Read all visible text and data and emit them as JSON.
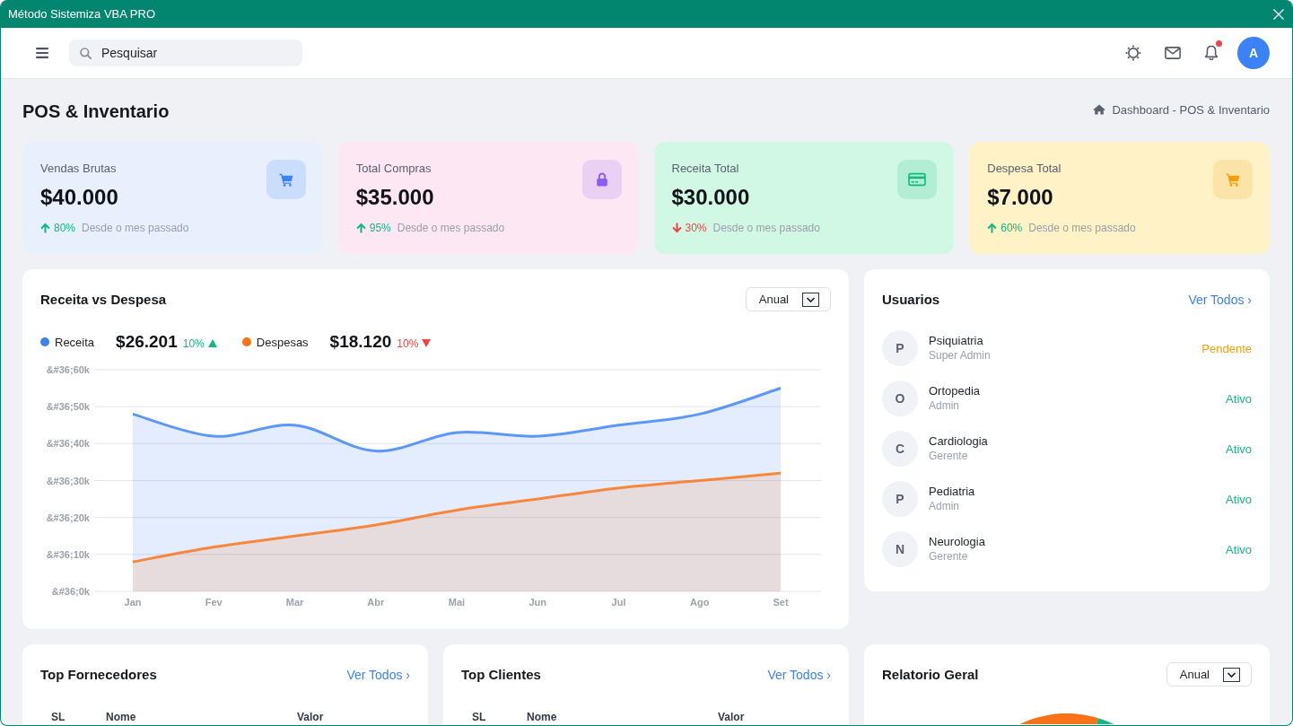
{
  "window": {
    "title": "Método Sistemiza VBA PRO"
  },
  "topbar": {
    "search": {
      "placeholder": "Pesquisar"
    },
    "notifications": {
      "unread": true
    },
    "avatar": {
      "initial": "A"
    }
  },
  "page": {
    "title": "POS & Inventario",
    "breadcrumb": "Dashboard - POS & Inventario"
  },
  "stats": [
    {
      "label": "Vendas Brutas",
      "value": "$40.000",
      "up": true,
      "change": "80%",
      "note": "Desde o mes passado",
      "color": "#e8effd",
      "icon": {
        "color": "#3b82f6"
      }
    },
    {
      "label": "Total Compras",
      "value": "$35.000",
      "up": true,
      "change": "95%",
      "note": "Desde o mes passado",
      "color": "#fde7f2",
      "icon": {
        "color": "#8b5cf6"
      }
    },
    {
      "label": "Receita Total",
      "value": "$30.000",
      "up": false,
      "change": "30%",
      "note": "Desde o mes passado",
      "color": "#d1f8e5",
      "icon": {
        "color": "#10b981"
      }
    },
    {
      "label": "Despesa Total",
      "value": "$7.000",
      "up": true,
      "change": "60%",
      "note": "Desde o mes passado",
      "color": "#fef2c6",
      "icon": {
        "color": "#f59e0b"
      }
    }
  ],
  "revenue_chart": {
    "title": "Receita vs Despesa",
    "period": "Anual",
    "legend": [
      {
        "label": "Receita",
        "color": "#3b82f6",
        "amount": "$26.201",
        "change": "10%",
        "up": true
      },
      {
        "label": "Despesas",
        "color": "#f97316",
        "amount": "$18.120",
        "change": "10%",
        "up": false
      }
    ],
    "y_axis_labels": [
      "&#36;60k",
      "&#36;50k",
      "&#36;40k",
      "&#36;30k",
      "&#36;20k",
      "&#36;10k",
      "&#36;0k"
    ],
    "x_axis_labels": [
      "Jan",
      "Fev",
      "Mar",
      "Abr",
      "Mai",
      "Jun",
      "Jul",
      "Ago",
      "Set"
    ]
  },
  "users": {
    "title": "Usuarios",
    "link": "Ver Todos ›",
    "items": [
      {
        "initial": "P",
        "name": "Psiquiatria",
        "role": "Super Admin",
        "status": "Pendente",
        "pending": true
      },
      {
        "initial": "O",
        "name": "Ortopedia",
        "role": "Admin",
        "status": "Ativo",
        "pending": false
      },
      {
        "initial": "C",
        "name": "Cardiologia",
        "role": "Gerente",
        "status": "Ativo",
        "pending": false
      },
      {
        "initial": "P",
        "name": "Pediatria",
        "role": "Admin",
        "status": "Ativo",
        "pending": false
      },
      {
        "initial": "N",
        "name": "Neurologia",
        "role": "Gerente",
        "status": "Ativo",
        "pending": false
      }
    ]
  },
  "suppliers": {
    "title": "Top Fornecedores",
    "link": "Ver Todos ›",
    "columns": [
      "SL",
      "Nome",
      "Valor"
    ]
  },
  "clients": {
    "title": "Top Clientes",
    "link": "Ver Todos ›",
    "columns": [
      "SL",
      "Nome",
      "Valor"
    ]
  },
  "report": {
    "title": "Relatorio Geral",
    "period": "Anual"
  }
}
